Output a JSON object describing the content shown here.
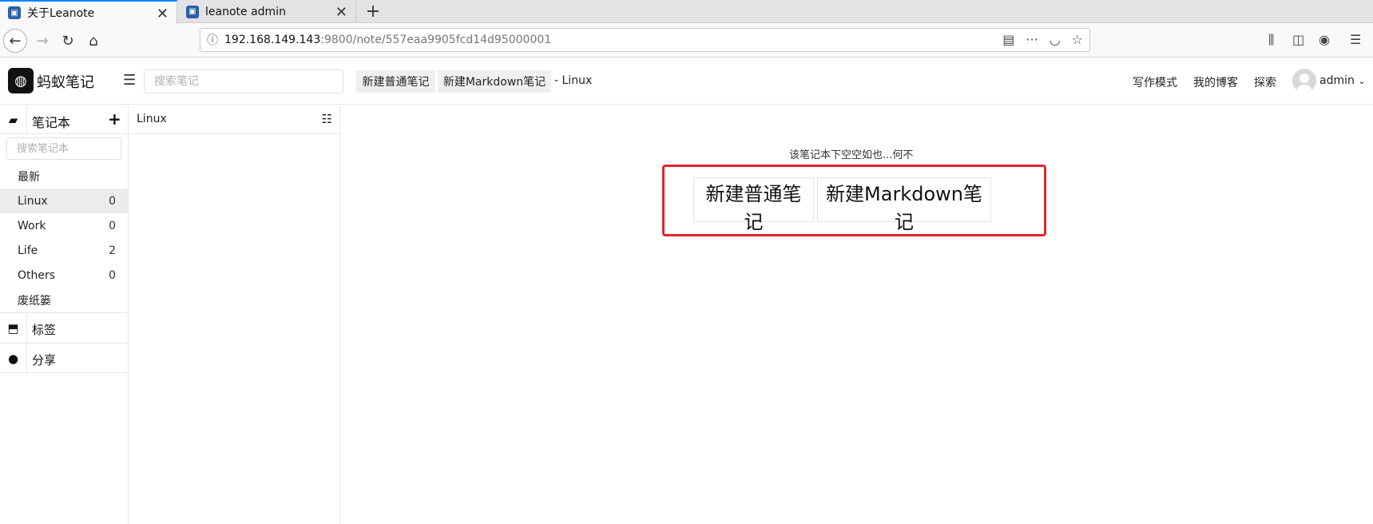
{
  "browser": {
    "tabs": [
      {
        "title": "关于Leanote",
        "active": true
      },
      {
        "title": "leanote admin",
        "active": false
      }
    ],
    "url_host": "192.168.149.143",
    "url_rest": ":9800/note/557eaa9905fcd14d95000001"
  },
  "header": {
    "logo_text": "蚂蚁笔记",
    "search_placeholder": "搜索笔记",
    "new_note_label": "新建普通笔记",
    "new_markdown_label": "新建Markdown笔记",
    "breadcrumb": "- Linux",
    "write_mode": "写作模式",
    "my_blog": "我的博客",
    "explore": "探索",
    "user": "admin"
  },
  "sidebar": {
    "title": "笔记本",
    "search_placeholder": "搜索笔记本",
    "latest": "最新",
    "notebooks": [
      {
        "name": "Linux",
        "count": "0"
      },
      {
        "name": "Work",
        "count": "0"
      },
      {
        "name": "Life",
        "count": "2"
      },
      {
        "name": "Others",
        "count": "0"
      }
    ],
    "trash": "废纸篓",
    "tags": "标签",
    "share": "分享"
  },
  "notelist": {
    "title": "Linux"
  },
  "main": {
    "empty_message": "该笔记本下空空如也...何不",
    "new_note_label": "新建普通笔记",
    "new_markdown_label": "新建Markdown笔记"
  },
  "colors": {
    "highlight": "#e0262b",
    "tab_accent": "#0a84ff"
  }
}
